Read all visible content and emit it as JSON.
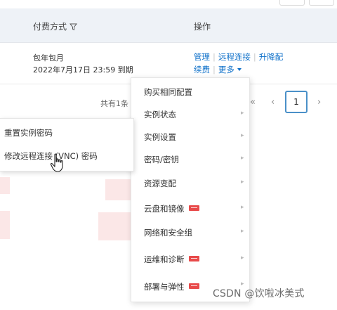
{
  "table": {
    "headers": {
      "billing": "付费方式",
      "actions": "操作"
    },
    "row": {
      "billing_type": "包年包月",
      "expiry": "2022年7月17日 23:59 到期",
      "actions": {
        "manage": "管理",
        "remote": "远程连接",
        "upgrade": "升降配",
        "renew": "续费",
        "more": "更多"
      }
    }
  },
  "pagination": {
    "total": "共有1条",
    "prev": "‹",
    "prev_far": "«",
    "next": "›",
    "current": "1"
  },
  "submenu": {
    "items": [
      "重置实例密码",
      "修改远程连接 (VNC) 密码"
    ]
  },
  "dropdown": {
    "items": [
      {
        "label": "购买相同配置",
        "has_arrow": false,
        "badge": false
      },
      {
        "label": "实例状态",
        "has_arrow": true,
        "badge": false
      },
      {
        "label": "实例设置",
        "has_arrow": true,
        "badge": false
      },
      {
        "label": "密码/密钥",
        "has_arrow": true,
        "badge": false
      },
      {
        "label": "资源变配",
        "has_arrow": true,
        "badge": false
      },
      {
        "label": "云盘和镜像",
        "has_arrow": true,
        "badge": true
      },
      {
        "label": "网络和安全组",
        "has_arrow": true,
        "badge": false
      },
      {
        "label": "运维和诊断",
        "has_arrow": true,
        "badge": true
      },
      {
        "label": "部署与弹性",
        "has_arrow": true,
        "badge": true
      }
    ]
  },
  "watermark": "CSDN @饮啦冰美式",
  "colors": {
    "link": "#0c6fc9",
    "header_bg": "#eef2f7",
    "badge": "#e84a4a",
    "active_page_border": "#4a90c8"
  }
}
